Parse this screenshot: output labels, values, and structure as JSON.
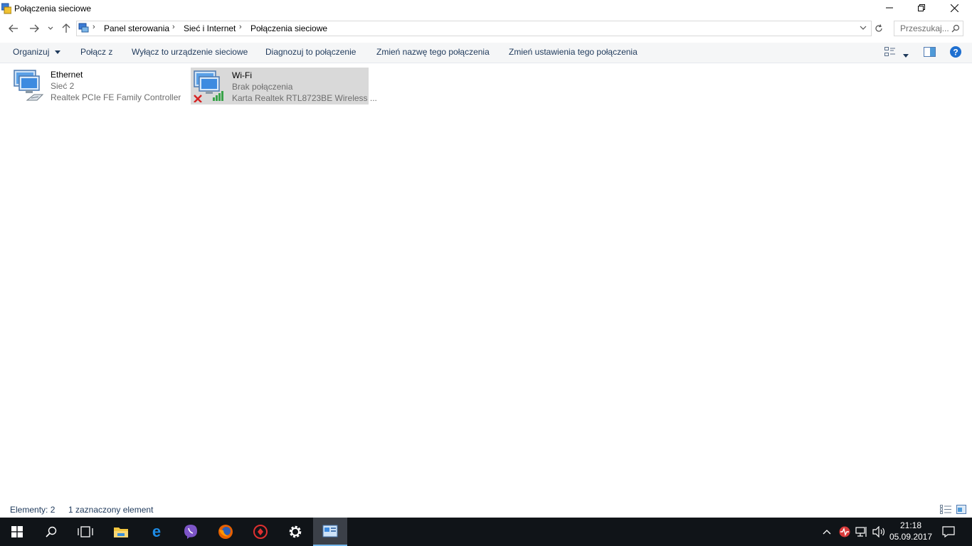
{
  "window": {
    "title": "Połączenia sieciowe"
  },
  "address": {
    "crumbs": [
      "Panel sterowania",
      "Sieć i Internet",
      "Połączenia sieciowe"
    ],
    "search_placeholder": "Przeszukaj..."
  },
  "commands": {
    "organize": "Organizuj",
    "connect": "Połącz z",
    "disable": "Wyłącz to urządzenie sieciowe",
    "diagnose": "Diagnozuj to połączenie",
    "rename": "Zmień nazwę tego połączenia",
    "change_settings": "Zmień ustawienia tego połączenia"
  },
  "items": [
    {
      "name": "Ethernet",
      "status": "Sieć  2",
      "device": "Realtek PCIe FE Family Controller",
      "icon": "ethernet-adapter-icon"
    },
    {
      "name": "Wi-Fi",
      "status": "Brak połączenia",
      "device": "Karta Realtek RTL8723BE Wireless ...",
      "icon": "wifi-adapter-icon",
      "selected": true
    }
  ],
  "status": {
    "count": "Elementy: 2",
    "selected": "1 zaznaczony element"
  },
  "taskbar": {
    "time": "21:18",
    "date": "05.09.2017"
  },
  "colors": {
    "selection": "#d9d9d9",
    "command_text": "#1e395b",
    "taskbar": "#101418"
  }
}
